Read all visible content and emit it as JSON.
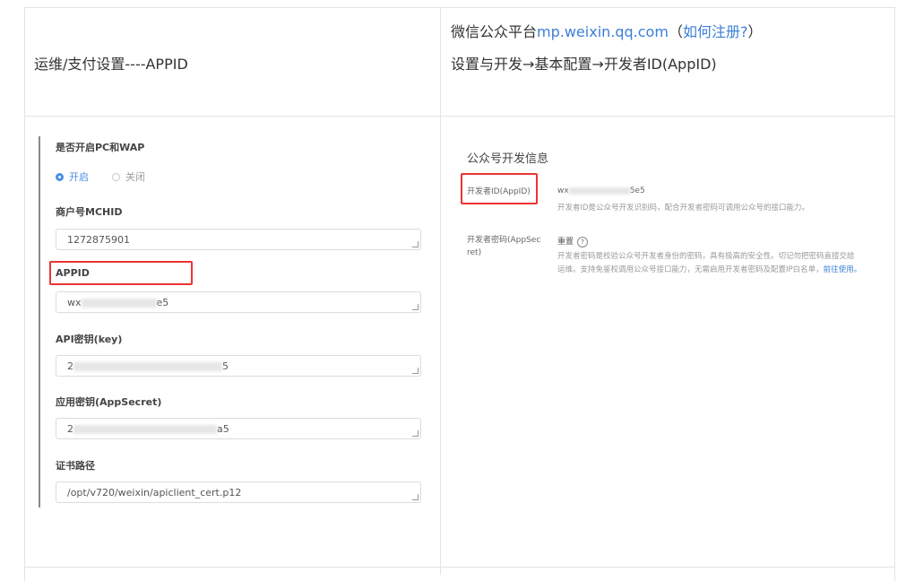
{
  "table": {
    "left_header": "运维/支付设置----APPID",
    "right_line1_prefix": "微信公众平台",
    "right_line1_link": "mp.weixin.qq.com",
    "right_line1_paren_open": "（",
    "right_line1_register": "如何注册?",
    "right_line1_paren_close": "）",
    "right_line2": "设置与开发→基本配置→开发者ID(AppID)"
  },
  "left_panel": {
    "pc_wap_label": "是否开启PC和WAP",
    "radio_on": "开启",
    "radio_off": "关闭",
    "mchid_label": "商户号MCHID",
    "mchid_value": "1272875901",
    "appid_label": "APPID",
    "appid_prefix": "wx",
    "appid_suffix": "e5",
    "apikey_label": "API密钥(key)",
    "apikey_prefix": "2",
    "apikey_suffix": "5",
    "appsecret_label": "应用密钥(AppSecret)",
    "appsecret_prefix": "2",
    "appsecret_suffix": "a5",
    "cert_label": "证书路径",
    "cert_value": "/opt/v720/weixin/apiclient_cert.p12"
  },
  "right_panel": {
    "title": "公众号开发信息",
    "devid_label": "开发者ID(AppID)",
    "devid_prefix": "wx",
    "devid_suffix": "5e5",
    "devid_desc": "开发者ID是公众号开发识别码，配合开发者密码可调用公众号的接口能力。",
    "secret_label_1": "开发者密码(AppSec",
    "secret_label_2": "ret)",
    "reset_link": "重置",
    "help_icon": "?",
    "secret_desc_1": "开发者密码是校验公众号开发者身份的密码，具有极高的安全性。切记勿把密码直接交给",
    "secret_desc_2_prefix": "运维。支持免鉴权调用公众号接口能力，无需启用开发者密码及配置IP白名单，",
    "secret_desc_2_link": "前往使用。"
  },
  "colors": {
    "accent": "#3a7fd5",
    "highlight": "#e33333",
    "radio_on": "#4a8fe2"
  }
}
